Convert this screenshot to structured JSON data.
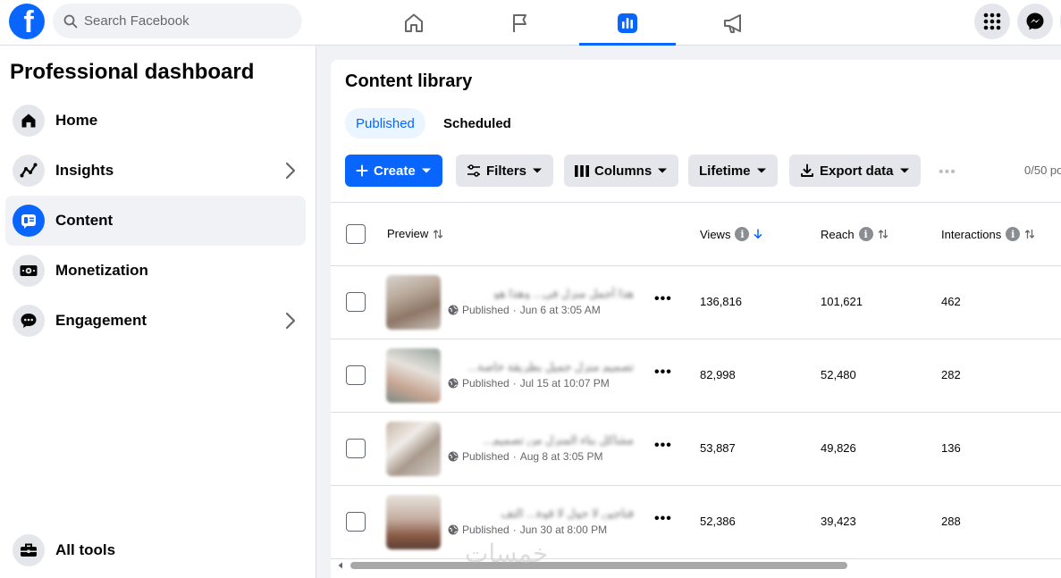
{
  "topbar": {
    "logo_letter": "f",
    "search_placeholder": "Search Facebook",
    "nav": [
      {
        "name": "home-icon"
      },
      {
        "name": "flag-icon"
      },
      {
        "name": "dashboard-icon"
      },
      {
        "name": "megaphone-icon"
      }
    ],
    "accent": "#0866ff"
  },
  "sidebar": {
    "title": "Professional dashboard",
    "items": [
      {
        "label": "Home",
        "icon": "home-icon"
      },
      {
        "label": "Insights",
        "icon": "insights-icon"
      },
      {
        "label": "Content",
        "icon": "content-icon"
      },
      {
        "label": "Monetization",
        "icon": "money-icon"
      },
      {
        "label": "Engagement",
        "icon": "chat-icon"
      }
    ],
    "bottom": {
      "label": "All tools",
      "icon": "toolbox-icon"
    }
  },
  "main": {
    "title": "Content library",
    "tabs": [
      {
        "label": "Published"
      },
      {
        "label": "Scheduled"
      }
    ],
    "toolbar": {
      "create": "Create",
      "filters": "Filters",
      "columns": "Columns",
      "lifetime": "Lifetime",
      "export": "Export data",
      "more": "•••",
      "page_count": "0/50 po"
    },
    "columns": {
      "preview": "Preview",
      "views": "Views",
      "reach": "Reach",
      "interactions": "Interactions"
    },
    "rows": [
      {
        "caption": "هذا أجمل منزل في... وهذا هو",
        "status": "Published",
        "date": "Jun 6 at 3:05 AM",
        "views": "136,816",
        "reach": "101,621",
        "interactions": "462"
      },
      {
        "caption": "تصميم منزل جميل بطريقة خاصة...",
        "status": "Published",
        "date": "Jul 15 at 10:07 PM",
        "views": "82,998",
        "reach": "52,480",
        "interactions": "282"
      },
      {
        "caption": "مشاكل بناء المنزل من تصميم...",
        "status": "Published",
        "date": "Aug 8 at 3:05 PM",
        "views": "53,887",
        "reach": "49,826",
        "interactions": "136"
      },
      {
        "caption": "فناجين لا حول لا قوة... التف",
        "status": "Published",
        "date": "Jun 30 at 8:00 PM",
        "views": "52,386",
        "reach": "39,423",
        "interactions": "288"
      }
    ]
  },
  "watermark": "خمسات"
}
